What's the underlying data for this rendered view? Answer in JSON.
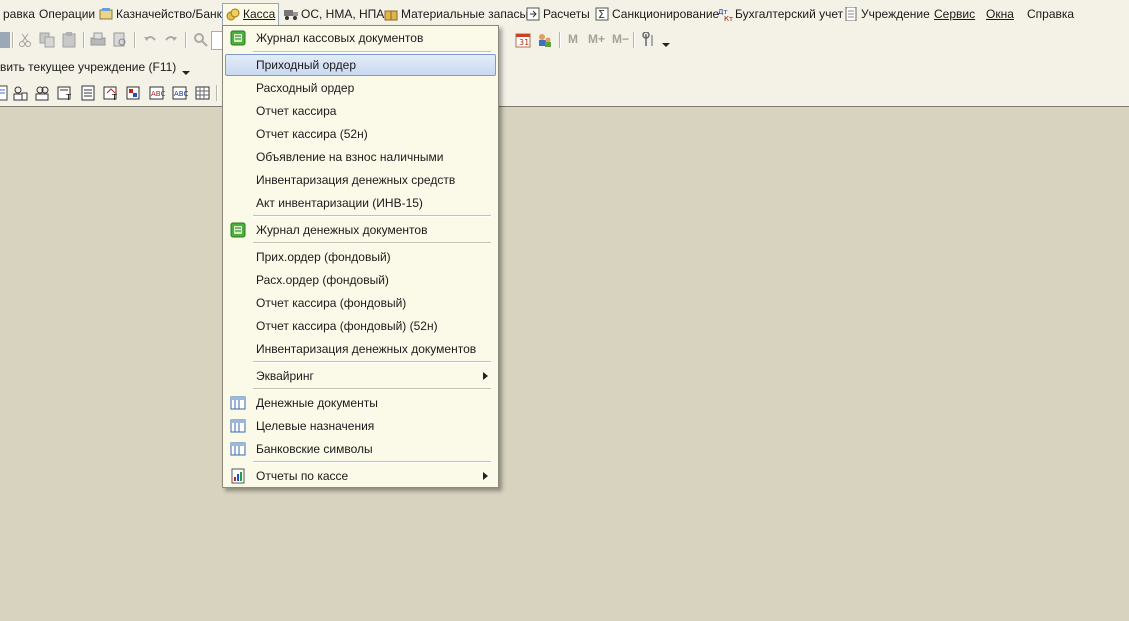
{
  "menubar": {
    "items": [
      {
        "label": "равка"
      },
      {
        "label": "Операции"
      },
      {
        "label": "Казначейство/Банк"
      },
      {
        "label": "Касса"
      },
      {
        "label": "ОС, НМА, НПА"
      },
      {
        "label": "Материальные запасы"
      },
      {
        "label": "Расчеты"
      },
      {
        "label": "Санкционирование"
      },
      {
        "label": "Бухгалтерский учет"
      },
      {
        "label": "Учреждение"
      },
      {
        "label": "Сервис"
      },
      {
        "label": "Окна"
      },
      {
        "label": "Справка"
      }
    ]
  },
  "toolbar": {
    "org_label": "вить текущее учреждение (F11)",
    "m_buttons": [
      "M",
      "M+",
      "M−"
    ]
  },
  "dropdown": {
    "items": [
      {
        "label": "Журнал кассовых документов",
        "icon": "journal-icon"
      },
      {
        "label": "Приходный ордер",
        "highlighted": true
      },
      {
        "label": "Расходный ордер"
      },
      {
        "label": "Отчет кассира"
      },
      {
        "label": "Отчет кассира (52н)"
      },
      {
        "label": "Объявление на взнос наличными"
      },
      {
        "label": "Инвентаризация денежных средств"
      },
      {
        "label": "Акт инвентаризации (ИНВ-15)"
      },
      {
        "label": "Журнал денежных документов",
        "icon": "journal-icon"
      },
      {
        "label": "Прих.ордер (фондовый)"
      },
      {
        "label": "Расх.ордер (фондовый)"
      },
      {
        "label": "Отчет кассира (фондовый)"
      },
      {
        "label": "Отчет кассира (фондовый) (52н)"
      },
      {
        "label": "Инвентаризация денежных документов"
      },
      {
        "label": "Эквайринг",
        "submenu": true
      },
      {
        "label": "Денежные документы",
        "icon": "catalog-icon"
      },
      {
        "label": "Целевые назначения",
        "icon": "catalog-icon"
      },
      {
        "label": "Банковские символы",
        "icon": "catalog-icon"
      },
      {
        "label": "Отчеты по кассе",
        "icon": "report-icon",
        "submenu": true
      }
    ]
  },
  "colors": {
    "background": "#d8d3bf",
    "panel": "#f4f2e6",
    "menu": "#fbfae9",
    "highlight": "#c9d9f0"
  }
}
